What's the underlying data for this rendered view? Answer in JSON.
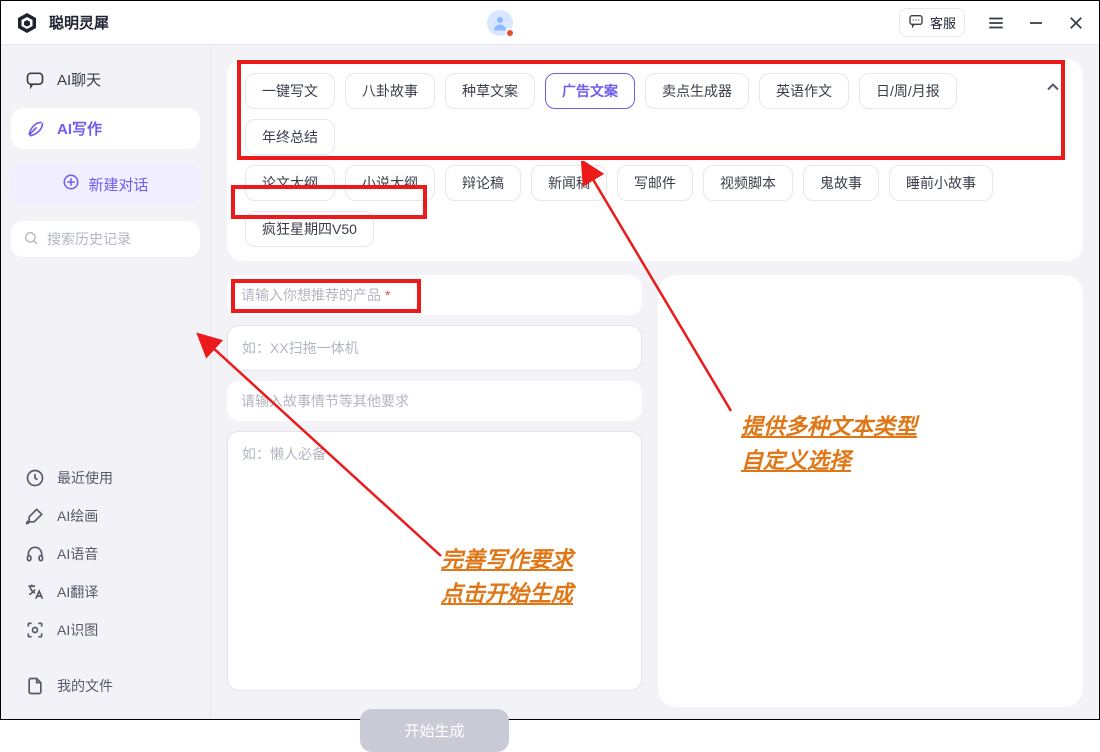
{
  "titlebar": {
    "app_name": "聪明灵犀",
    "support_label": "客服"
  },
  "sidebar": {
    "nav_chat": "AI聊天",
    "nav_write": "AI写作",
    "new_chat_label": "新建对话",
    "search_placeholder": "搜索历史记录",
    "recent_label": "最近使用",
    "paint_label": "AI绘画",
    "voice_label": "AI语音",
    "translate_label": "AI翻译",
    "vision_label": "AI识图",
    "files_label": "我的文件"
  },
  "tags": {
    "row1": [
      "一键写文",
      "八卦故事",
      "种草文案",
      "广告文案",
      "卖点生成器",
      "英语作文",
      "日/周/月报",
      "年终总结"
    ],
    "row2": [
      "论文大纲",
      "小说大纲",
      "辩论稿",
      "新闻稿",
      "写邮件",
      "视频脚本",
      "鬼故事",
      "睡前小故事",
      "疯狂星期四V50"
    ],
    "active_index_row1": 3
  },
  "form": {
    "product_label": "请输入你想推荐的产品",
    "product_placeholder": "如：XX扫拖一体机",
    "story_label": "请输入故事情节等其他要求",
    "story_placeholder": "如：懒人必备",
    "start_button": "开始生成"
  },
  "annotations": {
    "right1": "提供多种文本类型",
    "right2": "自定义选择",
    "mid1": "完善写作要求",
    "mid2": "点击开始生成"
  }
}
